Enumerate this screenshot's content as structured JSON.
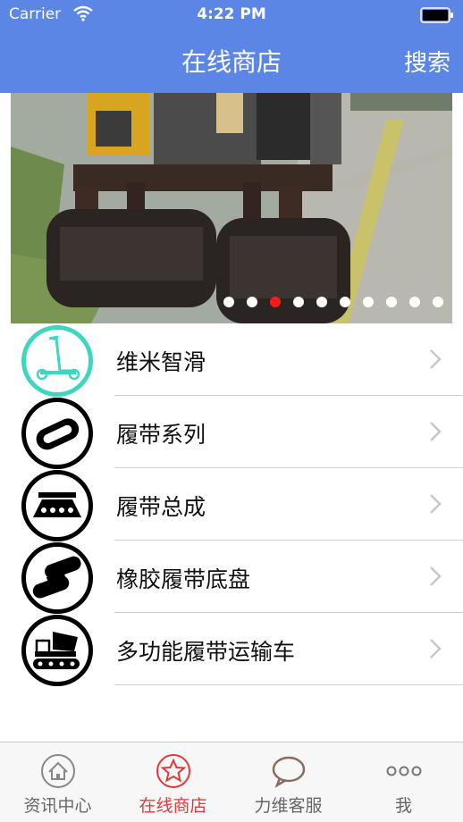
{
  "status_bar": {
    "carrier": "Carrier",
    "time": "4:22 PM"
  },
  "nav": {
    "title": "在线商店",
    "search_label": "搜索"
  },
  "banner": {
    "page_count": 10,
    "active_index": 2
  },
  "categories": [
    {
      "label": "维米智滑",
      "icon": "scooter-icon"
    },
    {
      "label": "履带系列",
      "icon": "track-belt-icon"
    },
    {
      "label": "履带总成",
      "icon": "track-assembly-icon"
    },
    {
      "label": "橡胶履带底盘",
      "icon": "rubber-track-chassis-icon"
    },
    {
      "label": "多功能履带运输车",
      "icon": "track-dumper-icon"
    }
  ],
  "tabs": [
    {
      "label": "资讯中心",
      "icon": "home-icon",
      "active": false
    },
    {
      "label": "在线商店",
      "icon": "star-icon",
      "active": true
    },
    {
      "label": "力维客服",
      "icon": "chat-bubble-icon",
      "active": false
    },
    {
      "label": "我",
      "icon": "more-dots-icon",
      "active": false
    }
  ],
  "colors": {
    "nav_bg": "#5b86e5",
    "accent_red": "#e23a3a",
    "teal": "#3fd6bf"
  }
}
